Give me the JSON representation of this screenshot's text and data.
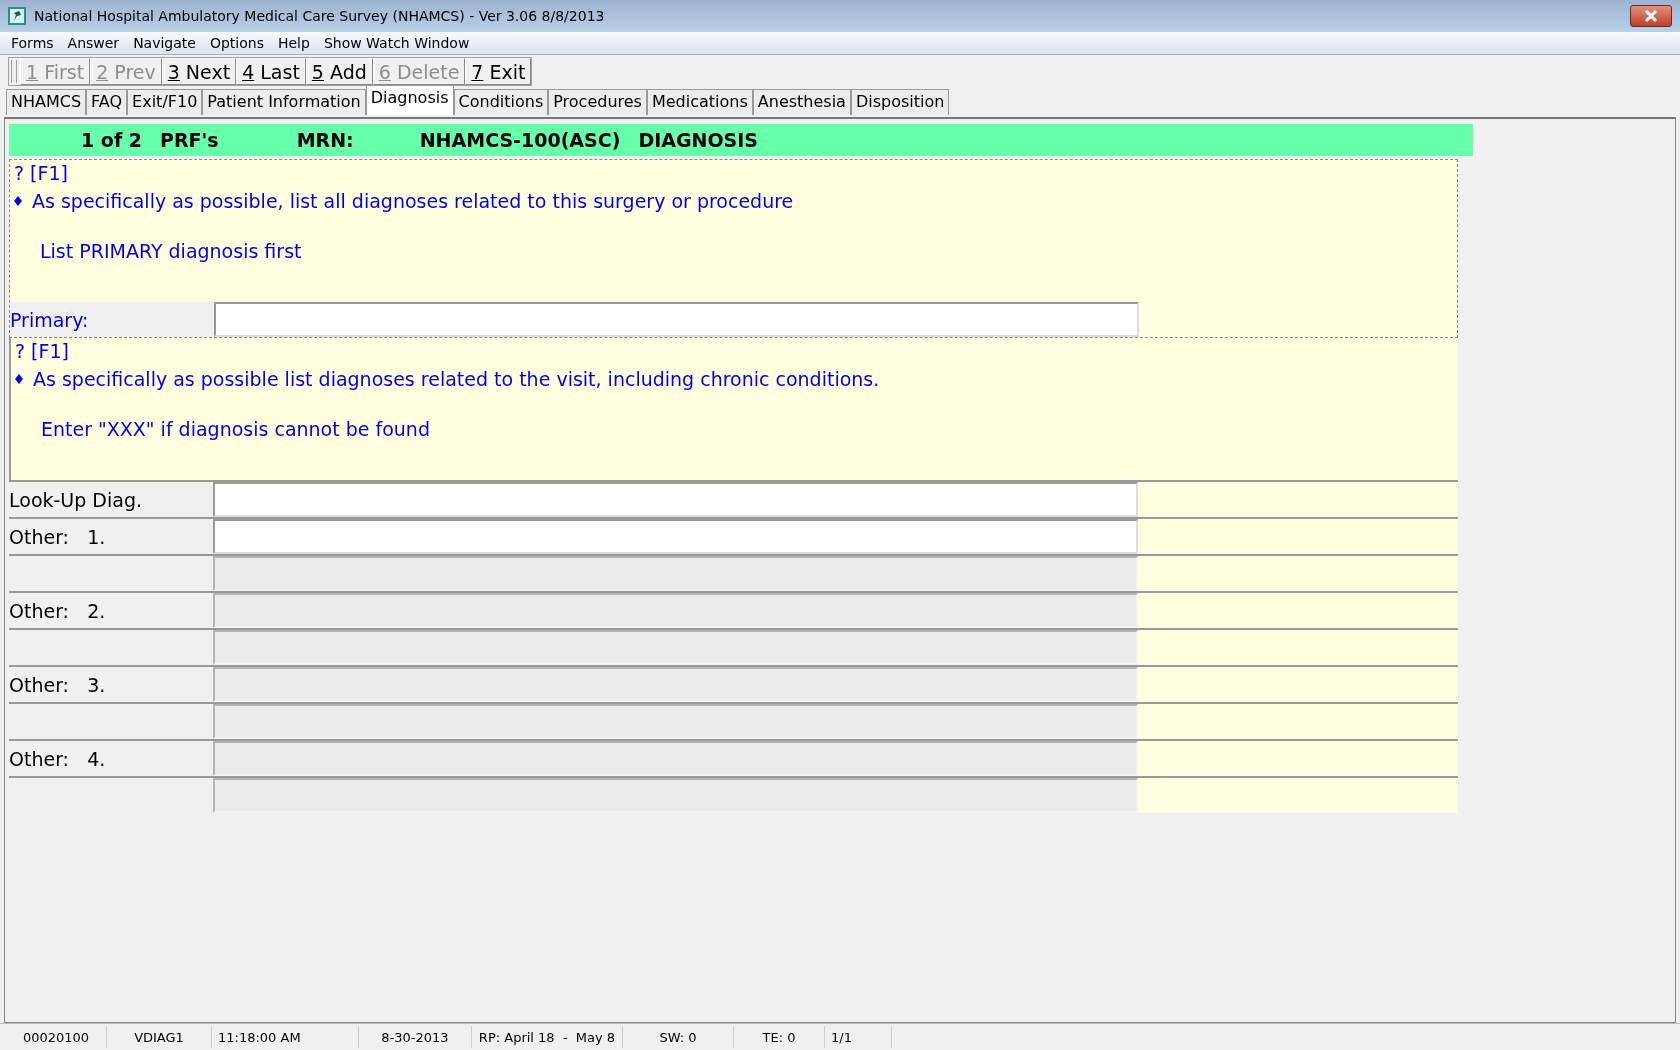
{
  "window": {
    "title": "National Hospital Ambulatory Medical Care Survey (NHAMCS) - Ver 3.06 8/8/2013"
  },
  "menu": [
    "Forms",
    "Answer",
    "Navigate",
    "Options",
    "Help",
    "Show Watch Window"
  ],
  "toolbar": [
    {
      "key": "1",
      "label": "First",
      "disabled": true
    },
    {
      "key": "2",
      "label": "Prev",
      "disabled": true
    },
    {
      "key": "3",
      "label": "Next",
      "disabled": false
    },
    {
      "key": "4",
      "label": "Last",
      "disabled": false
    },
    {
      "key": "5",
      "label": "Add",
      "disabled": false
    },
    {
      "key": "6",
      "label": "Delete",
      "disabled": true
    },
    {
      "key": "7",
      "label": "Exit",
      "disabled": false
    }
  ],
  "tabs": [
    {
      "label": "NHAMCS",
      "selected": false
    },
    {
      "label": "FAQ",
      "selected": false
    },
    {
      "label": "Exit/F10",
      "selected": false
    },
    {
      "label": "Patient Information",
      "selected": false
    },
    {
      "label": "Diagnosis",
      "selected": true
    },
    {
      "label": "Conditions",
      "selected": false
    },
    {
      "label": "Procedures",
      "selected": false
    },
    {
      "label": "Medications",
      "selected": false
    },
    {
      "label": "Anesthesia",
      "selected": false
    },
    {
      "label": "Disposition",
      "selected": false
    }
  ],
  "header": {
    "count": "1 of 2",
    "form": "PRF's",
    "mrn_label": "MRN:",
    "instrument": "NHAMCS-100(ASC)",
    "section": "DIAGNOSIS"
  },
  "questions": [
    {
      "help": "? [F1]",
      "text": "As specifically as possible, list all diagnoses related to this surgery or procedure",
      "note": "List PRIMARY diagnosis first",
      "rows": [
        {
          "label": "Primary:",
          "kind": "question",
          "disabled": false
        }
      ]
    },
    {
      "help": "? [F1]",
      "text": "As specifically as possible list diagnoses related to the visit, including chronic conditions.",
      "note": "Enter \"XXX\" if diagnosis cannot be found",
      "rows": [
        {
          "label": "Look-Up Diag.",
          "kind": "plain",
          "disabled": false
        },
        {
          "label": "Other:   1.",
          "kind": "plain",
          "disabled": false
        },
        {
          "kind": "blank",
          "disabled": true
        },
        {
          "label": "Other:   2.",
          "kind": "plain",
          "disabled": true
        },
        {
          "kind": "blank",
          "disabled": true
        },
        {
          "label": "Other:   3.",
          "kind": "plain",
          "disabled": true
        },
        {
          "kind": "blank",
          "disabled": true
        },
        {
          "label": "Other:   4.",
          "kind": "plain",
          "disabled": true
        },
        {
          "kind": "blank",
          "disabled": true
        }
      ]
    }
  ],
  "status_bar": [
    "00020100",
    "VDIAG1",
    "11:18:00 AM",
    "8-30-2013",
    "RP: April 18  -  May 8",
    "SW: 0",
    "TE: 0",
    "1/1"
  ]
}
